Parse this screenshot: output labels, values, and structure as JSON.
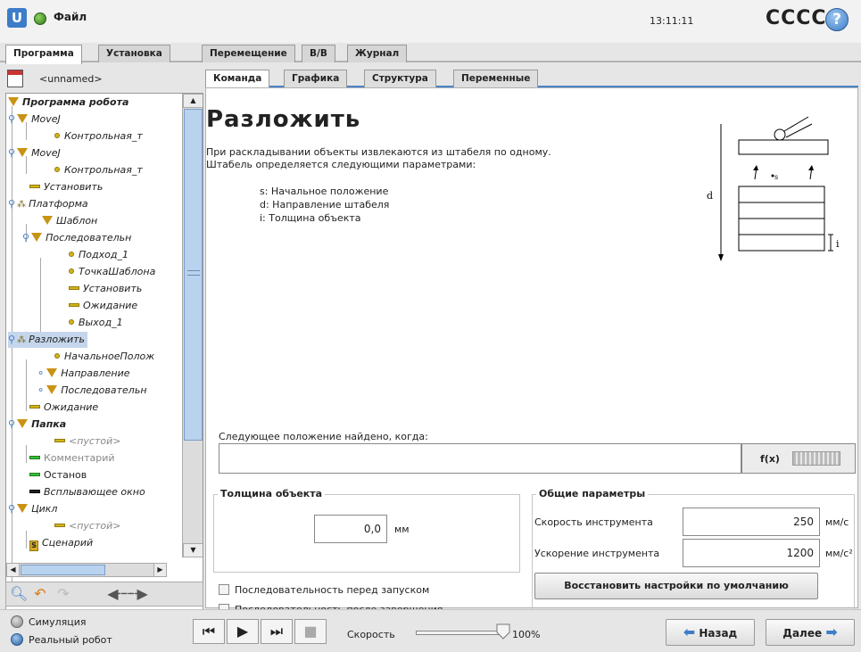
{
  "header": {
    "file_menu": "Файл",
    "clock": "13:11:11",
    "robot_name": "CCCC",
    "help": "?"
  },
  "main_tabs": [
    "Программа",
    "Установка",
    "Перемещение",
    "В/В",
    "Журнал"
  ],
  "program": {
    "name": "<unnamed>"
  },
  "tree": [
    {
      "label": "Программа робота",
      "icon": "triangle"
    },
    {
      "label": "MoveJ",
      "icon": "triangle"
    },
    {
      "label": "Контрольная_т",
      "icon": "waypoint"
    },
    {
      "label": "MoveJ",
      "icon": "triangle"
    },
    {
      "label": "Контрольная_т",
      "icon": "waypoint"
    },
    {
      "label": "Установить",
      "icon": "dash"
    },
    {
      "label": "Платформа",
      "icon": "pallet"
    },
    {
      "label": "Шаблон",
      "icon": "triangle"
    },
    {
      "label": "Последовательн",
      "icon": "triangle"
    },
    {
      "label": "Подход_1",
      "icon": "waypoint"
    },
    {
      "label": "ТочкаШаблона",
      "icon": "waypoint"
    },
    {
      "label": "Установить",
      "icon": "dash"
    },
    {
      "label": "Ожидание",
      "icon": "dash"
    },
    {
      "label": "Выход_1",
      "icon": "waypoint"
    },
    {
      "label": "Разложить",
      "icon": "pallet"
    },
    {
      "label": "НачальноеПолож",
      "icon": "waypoint"
    },
    {
      "label": "Направление",
      "icon": "triangle"
    },
    {
      "label": "Последовательн",
      "icon": "triangle"
    },
    {
      "label": "Ожидание",
      "icon": "dash"
    },
    {
      "label": "Папка",
      "icon": "triangle"
    },
    {
      "label": "<пустой>",
      "icon": "dash"
    },
    {
      "label": "Комментарий",
      "icon": "green-dash"
    },
    {
      "label": "Останов",
      "icon": "green-dash"
    },
    {
      "label": "Всплывающее окно",
      "icon": "black-dash"
    },
    {
      "label": "Цикл",
      "icon": "triangle"
    },
    {
      "label": "<пустой>",
      "icon": "dash"
    },
    {
      "label": "Сценарий",
      "icon": "script"
    }
  ],
  "sub_tabs": [
    "Команда",
    "Графика",
    "Структура",
    "Переменные"
  ],
  "command": {
    "title": "Разложить",
    "desc_line1": "При раскладывании объекты извлекаются из штабеля по одному.",
    "desc_line2": "Штабель определяется следующими параметрами:",
    "param_s": "s: Начальное положение",
    "param_d": "d: Направление штабеля",
    "param_i": "i: Толщина объекта",
    "diagram_d": "d",
    "diagram_s": "s",
    "diagram_i": "i",
    "next_label": "Следующее положение найдено, когда:",
    "expression_value": "",
    "fx_label": "f(x)",
    "thickness": {
      "legend": "Толщина объекта",
      "value": "0,0",
      "unit": "мм"
    },
    "general": {
      "legend": "Общие параметры",
      "tool_speed_label": "Скорость инструмента",
      "tool_speed_value": "250",
      "tool_speed_unit": "мм/с",
      "tool_accel_label": "Ускорение инструмента",
      "tool_accel_value": "1200",
      "tool_accel_unit": "мм/с²"
    },
    "seq_before": "Последовательность перед запуском",
    "seq_after": "Последовательность после завершения",
    "restore_defaults": "Восстановить настройки по умолчанию"
  },
  "bottom": {
    "simulation": "Симуляция",
    "real_robot": "Реальный робот",
    "speed_label": "Скорость",
    "speed_value": "100%",
    "speed_fraction": 1.0,
    "back": "Назад",
    "next": "Далее"
  },
  "colors": {
    "accent": "#3f7ec8",
    "tree_icon": "#c99315",
    "selected": "#c5d6ec"
  }
}
